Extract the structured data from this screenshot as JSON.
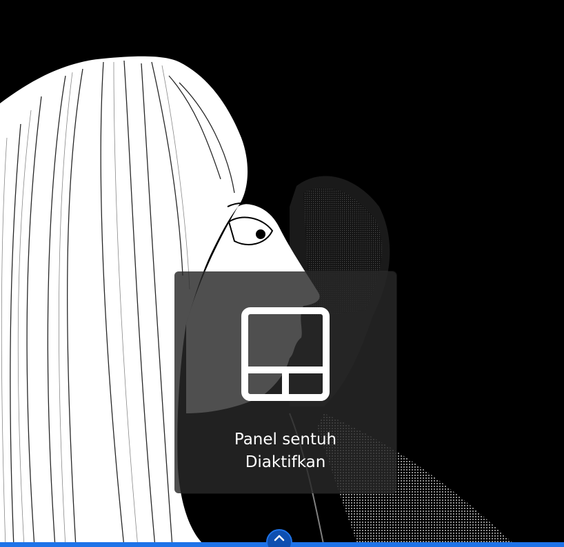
{
  "overlay": {
    "line1": "Panel sentuh",
    "line2": "Diaktifkan",
    "icon": "touchpad-icon"
  },
  "bottom_bar": {
    "handle_icon": "chevron-up-icon",
    "accent_color": "#1e73e8"
  }
}
